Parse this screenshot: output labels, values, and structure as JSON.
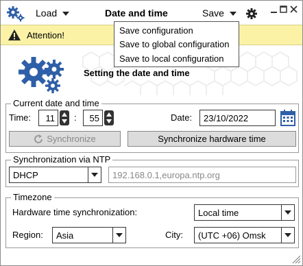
{
  "titlebar": {
    "load_label": "Load",
    "title": "Date and time",
    "save_label": "Save"
  },
  "attention": {
    "text": "Attention!"
  },
  "save_menu": {
    "items": [
      "Save configuration",
      "Save to global configuration",
      "Save to local configuration"
    ]
  },
  "header": {
    "heading": "Setting the date and time"
  },
  "current": {
    "legend": "Current date and time",
    "time_label": "Time:",
    "hours": "11",
    "separator": ":",
    "minutes": "55",
    "date_label": "Date:",
    "date": "23/10/2022",
    "synchronize_label": "Synchronize",
    "sync_hw_label": "Synchronize hardware time"
  },
  "ntp": {
    "legend": "Synchronization via NTP",
    "mode": "DHCP",
    "servers": "192.168.0.1,europa.ntp.org"
  },
  "timezone": {
    "legend": "Timezone",
    "hw_sync_label": "Hardware time synchronization:",
    "hw_sync_value": "Local time",
    "region_label": "Region:",
    "region_value": "Asia",
    "city_label": "City:",
    "city_value": "(UTC +06) Omsk"
  },
  "colors": {
    "attention_bg": "#fbf2a6",
    "icon_blue": "#2f5fa8"
  }
}
